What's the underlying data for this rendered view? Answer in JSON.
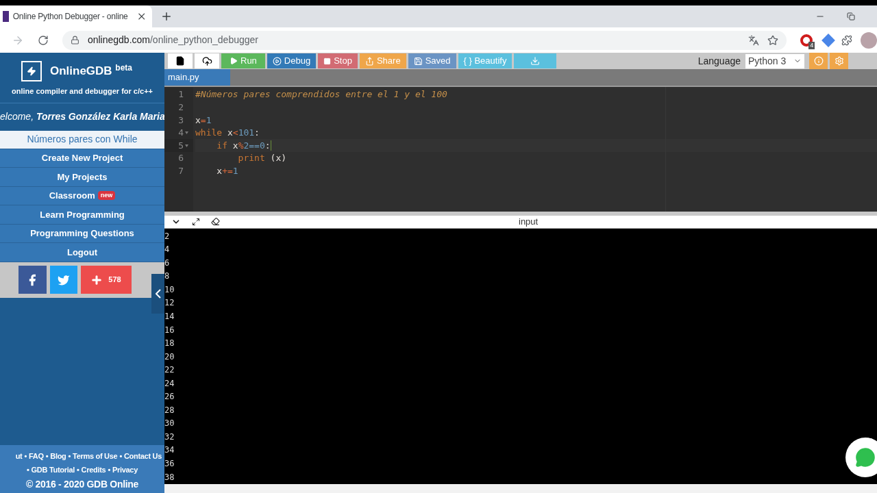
{
  "browser": {
    "tab": {
      "title": "Online Python Debugger - online"
    },
    "address": {
      "host": "onlinegdb.com",
      "path": "/online_python_debugger"
    },
    "extension_badge": "4"
  },
  "sidebar": {
    "brand": "OnlineGDB",
    "brand_tag": "beta",
    "tagline": "online compiler and debugger for c/c++",
    "welcome": "elcome, **Torres González Karla Maria**",
    "menu": [
      {
        "label": "Números pares con While",
        "selected": true
      },
      {
        "label": "Create New Project",
        "selected": false
      },
      {
        "label": "My Projects",
        "selected": false
      },
      {
        "label": "Classroom",
        "selected": false,
        "badge": "new"
      },
      {
        "label": "Learn Programming",
        "selected": false
      },
      {
        "label": "Programming Questions",
        "selected": false
      },
      {
        "label": "Logout",
        "selected": false
      }
    ],
    "share_count": "578",
    "footer": {
      "separator": "•",
      "lines": [
        {
          "leading_separator": false,
          "links": [
            "ut",
            "FAQ",
            "Blog",
            "Terms of Use",
            "Contact Us"
          ]
        },
        {
          "leading_separator": true,
          "links": [
            "GDB Tutorial",
            "Credits",
            "Privacy"
          ]
        }
      ],
      "copyright": "© 2016 - 2020 GDB Online"
    }
  },
  "toolbar": {
    "buttons": [
      {
        "kind": "new"
      },
      {
        "kind": "upload"
      },
      {
        "kind": "run",
        "label": "Run"
      },
      {
        "kind": "debug",
        "label": "Debug"
      },
      {
        "kind": "stop",
        "label": "Stop"
      },
      {
        "kind": "share",
        "label": "Share"
      },
      {
        "kind": "saved",
        "label": "Saved"
      },
      {
        "kind": "beautify",
        "label": "{ } Beautify"
      },
      {
        "kind": "download"
      }
    ],
    "language_label": "Language",
    "language": "Python 3"
  },
  "file_tabs": [
    {
      "label": "main.py",
      "selected": true
    }
  ],
  "editor": {
    "lines": [
      {
        "number": "1",
        "foldable": false,
        "active": false,
        "tokens": [
          {
            "kind": "comment",
            "text": "#Números pares comprendidos entre el 1 y el 100"
          }
        ]
      },
      {
        "number": "2",
        "foldable": false,
        "active": false
      },
      {
        "number": "3",
        "foldable": false,
        "active": false,
        "tokens": [
          {
            "kind": "var",
            "text": "x"
          },
          {
            "kind": "op",
            "text": "="
          },
          {
            "kind": "num",
            "text": "1"
          }
        ]
      },
      {
        "number": "4",
        "foldable": true,
        "active": false,
        "tokens": [
          {
            "kind": "keyword",
            "text": "while"
          },
          {
            "kind": "var",
            "text": " x"
          },
          {
            "kind": "op",
            "text": "<"
          },
          {
            "kind": "num",
            "text": "101"
          },
          {
            "kind": "var",
            "text": ":"
          }
        ]
      },
      {
        "number": "5",
        "foldable": true,
        "active": true,
        "tokens": [
          {
            "kind": "keyword",
            "text": "    if"
          },
          {
            "kind": "var",
            "text": " x"
          },
          {
            "kind": "op",
            "text": "%"
          },
          {
            "kind": "num",
            "text": "2==0"
          },
          {
            "kind": "var",
            "text": ":"
          }
        ]
      },
      {
        "number": "6",
        "foldable": false,
        "active": false,
        "tokens": [
          {
            "kind": "keyword",
            "text": "        print"
          },
          {
            "kind": "var",
            "text": " (x)"
          }
        ]
      },
      {
        "number": "7",
        "foldable": false,
        "active": false,
        "tokens": [
          {
            "kind": "var",
            "text": "    x"
          },
          {
            "kind": "op",
            "text": "+="
          },
          {
            "kind": "num",
            "text": "1"
          }
        ]
      }
    ]
  },
  "console": {
    "title": "input",
    "output": [
      "2",
      "4",
      "6",
      "8",
      "10",
      "12",
      "14",
      "16",
      "18",
      "20",
      "22",
      "24",
      "26",
      "28",
      "30",
      "32",
      "34",
      "36",
      "38"
    ]
  }
}
